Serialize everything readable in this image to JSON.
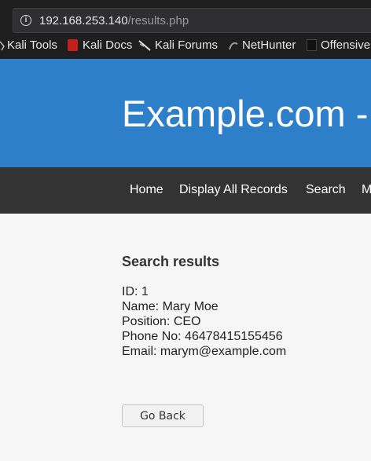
{
  "browser": {
    "url_host": "192.168.253.140",
    "url_path": "/results.php",
    "bookmarks": [
      {
        "label": "Kali Tools",
        "icon": "kali-icon"
      },
      {
        "label": "Kali Docs",
        "icon": "kali-docs-icon"
      },
      {
        "label": "Kali Forums",
        "icon": "kali-forums-icon"
      },
      {
        "label": "NetHunter",
        "icon": "nethunter-icon"
      },
      {
        "label": "Offensive",
        "icon": "offensive-security-icon"
      }
    ]
  },
  "site": {
    "title": "Example.com -",
    "nav": [
      "Home",
      "Display All Records",
      "Search",
      "M"
    ]
  },
  "results": {
    "heading": "Search results",
    "id_line": "ID: 1",
    "name_line": "Name: Mary Moe",
    "position_line": "Position: CEO",
    "phone_line": "Phone No: 46478415155456",
    "email_line": "Email: marym@example.com",
    "go_back_label": "Go Back"
  },
  "colors": {
    "header_blue": "#2e7fc9",
    "nav_dark": "#333333",
    "page_bg": "#f6f6f6"
  }
}
